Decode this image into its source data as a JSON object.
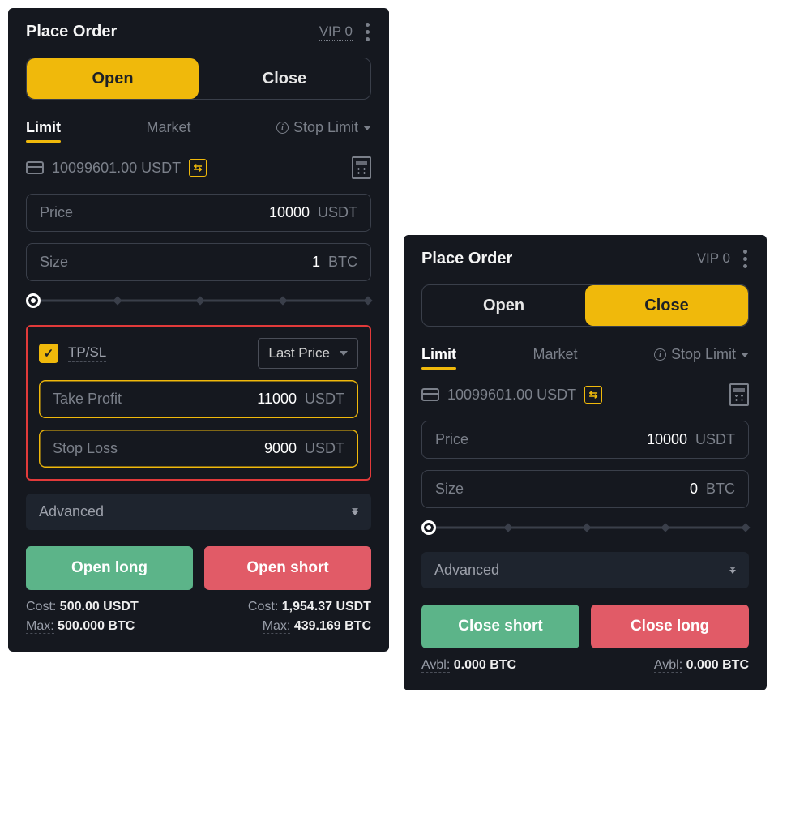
{
  "left": {
    "title": "Place Order",
    "vip": "VIP 0",
    "segment": {
      "open": "Open",
      "close": "Close",
      "active": "open"
    },
    "tabs": {
      "limit": "Limit",
      "market": "Market",
      "stop_limit": "Stop Limit"
    },
    "balance": "10099601.00 USDT",
    "price": {
      "label": "Price",
      "value": "10000",
      "unit": "USDT"
    },
    "size": {
      "label": "Size",
      "value": "1",
      "unit": "BTC"
    },
    "tpsl": {
      "label": "TP/SL",
      "mode": "Last Price",
      "tp": {
        "label": "Take Profit",
        "value": "11000",
        "unit": "USDT"
      },
      "sl": {
        "label": "Stop Loss",
        "value": "9000",
        "unit": "USDT"
      }
    },
    "advanced": "Advanced",
    "actions": {
      "long": "Open long",
      "short": "Open short"
    },
    "footer": {
      "cost_label": "Cost:",
      "cost_long": "500.00 USDT",
      "cost_short": "1,954.37 USDT",
      "max_label": "Max:",
      "max_long": "500.000 BTC",
      "max_short": "439.169 BTC"
    }
  },
  "right": {
    "title": "Place Order",
    "vip": "VIP 0",
    "segment": {
      "open": "Open",
      "close": "Close",
      "active": "close"
    },
    "tabs": {
      "limit": "Limit",
      "market": "Market",
      "stop_limit": "Stop Limit"
    },
    "balance": "10099601.00 USDT",
    "price": {
      "label": "Price",
      "value": "10000",
      "unit": "USDT"
    },
    "size": {
      "label": "Size",
      "value": "0",
      "unit": "BTC"
    },
    "advanced": "Advanced",
    "actions": {
      "short": "Close short",
      "long": "Close long"
    },
    "footer": {
      "avbl_label": "Avbl:",
      "avbl_short": "0.000 BTC",
      "avbl_long": "0.000 BTC"
    }
  }
}
